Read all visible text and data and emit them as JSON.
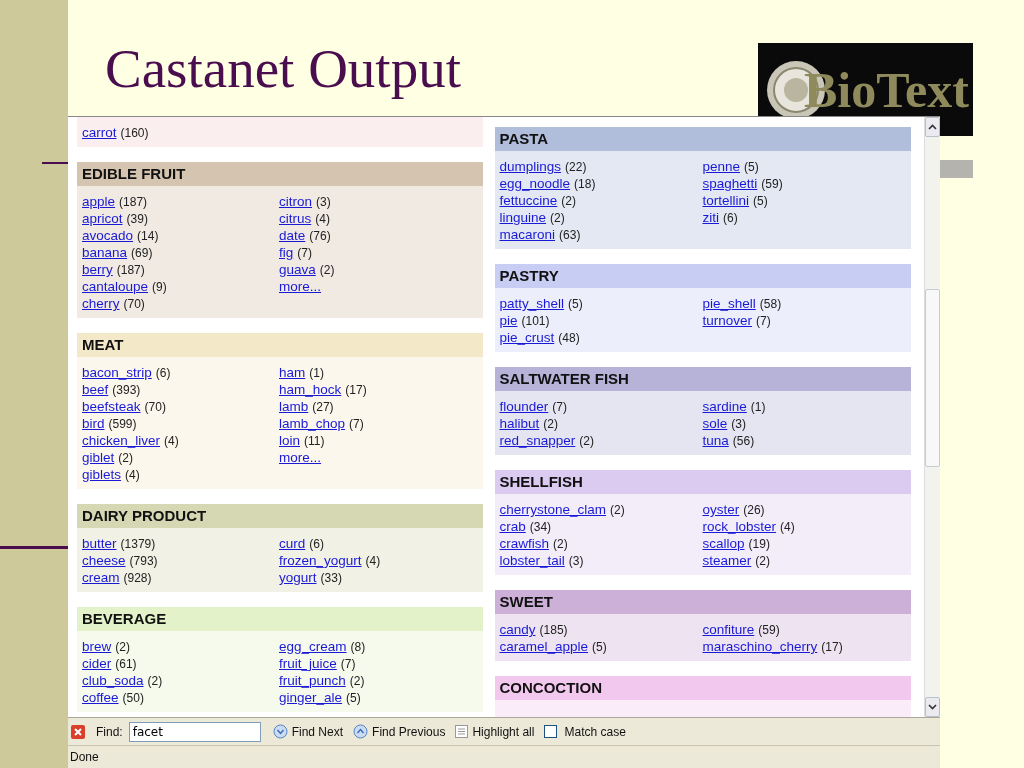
{
  "slide": {
    "title": "Castanet Output",
    "logo": "BioText"
  },
  "browser": {
    "left_column": [
      {
        "color": "#fbeeee",
        "columns": [
          [
            {
              "name": "carrot",
              "count": "(160)"
            }
          ],
          []
        ]
      },
      {
        "title": "EDIBLE FRUIT",
        "color": "#d5c4b0",
        "columns": [
          [
            {
              "name": "apple",
              "count": "(187)"
            },
            {
              "name": "apricot",
              "count": "(39)"
            },
            {
              "name": "avocado",
              "count": "(14)"
            },
            {
              "name": "banana",
              "count": "(69)"
            },
            {
              "name": "berry",
              "count": "(187)"
            },
            {
              "name": "cantaloupe",
              "count": "(9)"
            },
            {
              "name": "cherry",
              "count": "(70)"
            }
          ],
          [
            {
              "name": "citron",
              "count": "(3)"
            },
            {
              "name": "citrus",
              "count": "(4)"
            },
            {
              "name": "date",
              "count": "(76)"
            },
            {
              "name": "fig",
              "count": "(7)"
            },
            {
              "name": "guava",
              "count": "(2)"
            },
            {
              "name": "more..."
            }
          ]
        ]
      },
      {
        "title": "MEAT",
        "color": "#f3e8c8",
        "columns": [
          [
            {
              "name": "bacon_strip",
              "count": "(6)"
            },
            {
              "name": "beef",
              "count": "(393)"
            },
            {
              "name": "beefsteak",
              "count": "(70)"
            },
            {
              "name": "bird",
              "count": "(599)"
            },
            {
              "name": "chicken_liver",
              "count": "(4)"
            },
            {
              "name": "giblet",
              "count": "(2)"
            },
            {
              "name": "giblets",
              "count": "(4)"
            }
          ],
          [
            {
              "name": "ham",
              "count": "(1)"
            },
            {
              "name": "ham_hock",
              "count": "(17)"
            },
            {
              "name": "lamb",
              "count": "(27)"
            },
            {
              "name": "lamb_chop",
              "count": "(7)"
            },
            {
              "name": "loin",
              "count": "(11)"
            },
            {
              "name": "more..."
            }
          ]
        ]
      },
      {
        "title": "DAIRY PRODUCT",
        "color": "#d6d8b4",
        "columns": [
          [
            {
              "name": "butter",
              "count": "(1379)"
            },
            {
              "name": "cheese",
              "count": "(793)"
            },
            {
              "name": "cream",
              "count": "(928)"
            }
          ],
          [
            {
              "name": "curd",
              "count": "(6)"
            },
            {
              "name": "frozen_yogurt",
              "count": "(4)"
            },
            {
              "name": "yogurt",
              "count": "(33)"
            }
          ]
        ]
      },
      {
        "title": "BEVERAGE",
        "color": "#e3f2c8",
        "columns": [
          [
            {
              "name": "brew",
              "count": "(2)"
            },
            {
              "name": "cider",
              "count": "(61)"
            },
            {
              "name": "club_soda",
              "count": "(2)"
            },
            {
              "name": "coffee",
              "count": "(50)"
            }
          ],
          [
            {
              "name": "egg_cream",
              "count": "(8)"
            },
            {
              "name": "fruit_juice",
              "count": "(7)"
            },
            {
              "name": "fruit_punch",
              "count": "(2)"
            },
            {
              "name": "ginger_ale",
              "count": "(5)"
            }
          ]
        ]
      }
    ],
    "right_column": [
      {
        "title": "PASTA",
        "color": "#b0bedc",
        "columns": [
          [
            {
              "name": "dumplings",
              "count": "(22)"
            },
            {
              "name": "egg_noodle",
              "count": "(18)"
            },
            {
              "name": "fettuccine",
              "count": "(2)"
            },
            {
              "name": "linguine",
              "count": "(2)"
            },
            {
              "name": "macaroni",
              "count": "(63)"
            }
          ],
          [
            {
              "name": "penne",
              "count": "(5)"
            },
            {
              "name": "spaghetti",
              "count": "(59)"
            },
            {
              "name": "tortellini",
              "count": "(5)"
            },
            {
              "name": "ziti",
              "count": "(6)"
            }
          ]
        ]
      },
      {
        "title": "PASTRY",
        "color": "#c8cdf3",
        "columns": [
          [
            {
              "name": "patty_shell",
              "count": "(5)"
            },
            {
              "name": "pie",
              "count": "(101)"
            },
            {
              "name": "pie_crust",
              "count": "(48)"
            }
          ],
          [
            {
              "name": "pie_shell",
              "count": "(58)"
            },
            {
              "name": "turnover",
              "count": "(7)"
            }
          ]
        ]
      },
      {
        "title": "SALTWATER FISH",
        "color": "#b6b2d8",
        "columns": [
          [
            {
              "name": "flounder",
              "count": "(7)"
            },
            {
              "name": "halibut",
              "count": "(2)"
            },
            {
              "name": "red_snapper",
              "count": "(2)"
            }
          ],
          [
            {
              "name": "sardine",
              "count": "(1)"
            },
            {
              "name": "sole",
              "count": "(3)"
            },
            {
              "name": "tuna",
              "count": "(56)"
            }
          ]
        ]
      },
      {
        "title": "SHELLFISH",
        "color": "#dccbf0",
        "columns": [
          [
            {
              "name": "cherrystone_clam",
              "count": "(2)"
            },
            {
              "name": "crab",
              "count": "(34)"
            },
            {
              "name": "crawfish",
              "count": "(2)"
            },
            {
              "name": "lobster_tail",
              "count": "(3)"
            }
          ],
          [
            {
              "name": "oyster",
              "count": "(26)"
            },
            {
              "name": "rock_lobster",
              "count": "(4)"
            },
            {
              "name": "scallop",
              "count": "(19)"
            },
            {
              "name": "steamer",
              "count": "(2)"
            }
          ]
        ]
      },
      {
        "title": "SWEET",
        "color": "#cdb0d8",
        "columns": [
          [
            {
              "name": "candy",
              "count": "(185)"
            },
            {
              "name": "caramel_apple",
              "count": "(5)"
            }
          ],
          [
            {
              "name": "confiture",
              "count": "(59)"
            },
            {
              "name": "maraschino_cherry",
              "count": "(17)"
            }
          ]
        ]
      },
      {
        "title": "CONCOCTION",
        "color": "#f3c8ef",
        "columns": [
          [],
          []
        ]
      }
    ],
    "find_bar": {
      "label": "Find:",
      "value": "facet",
      "next": "Find Next",
      "previous": "Find Previous",
      "highlight": "Highlight all",
      "match_case": {
        "label": "Match case",
        "checked": false
      }
    },
    "status_bar": "Done"
  }
}
